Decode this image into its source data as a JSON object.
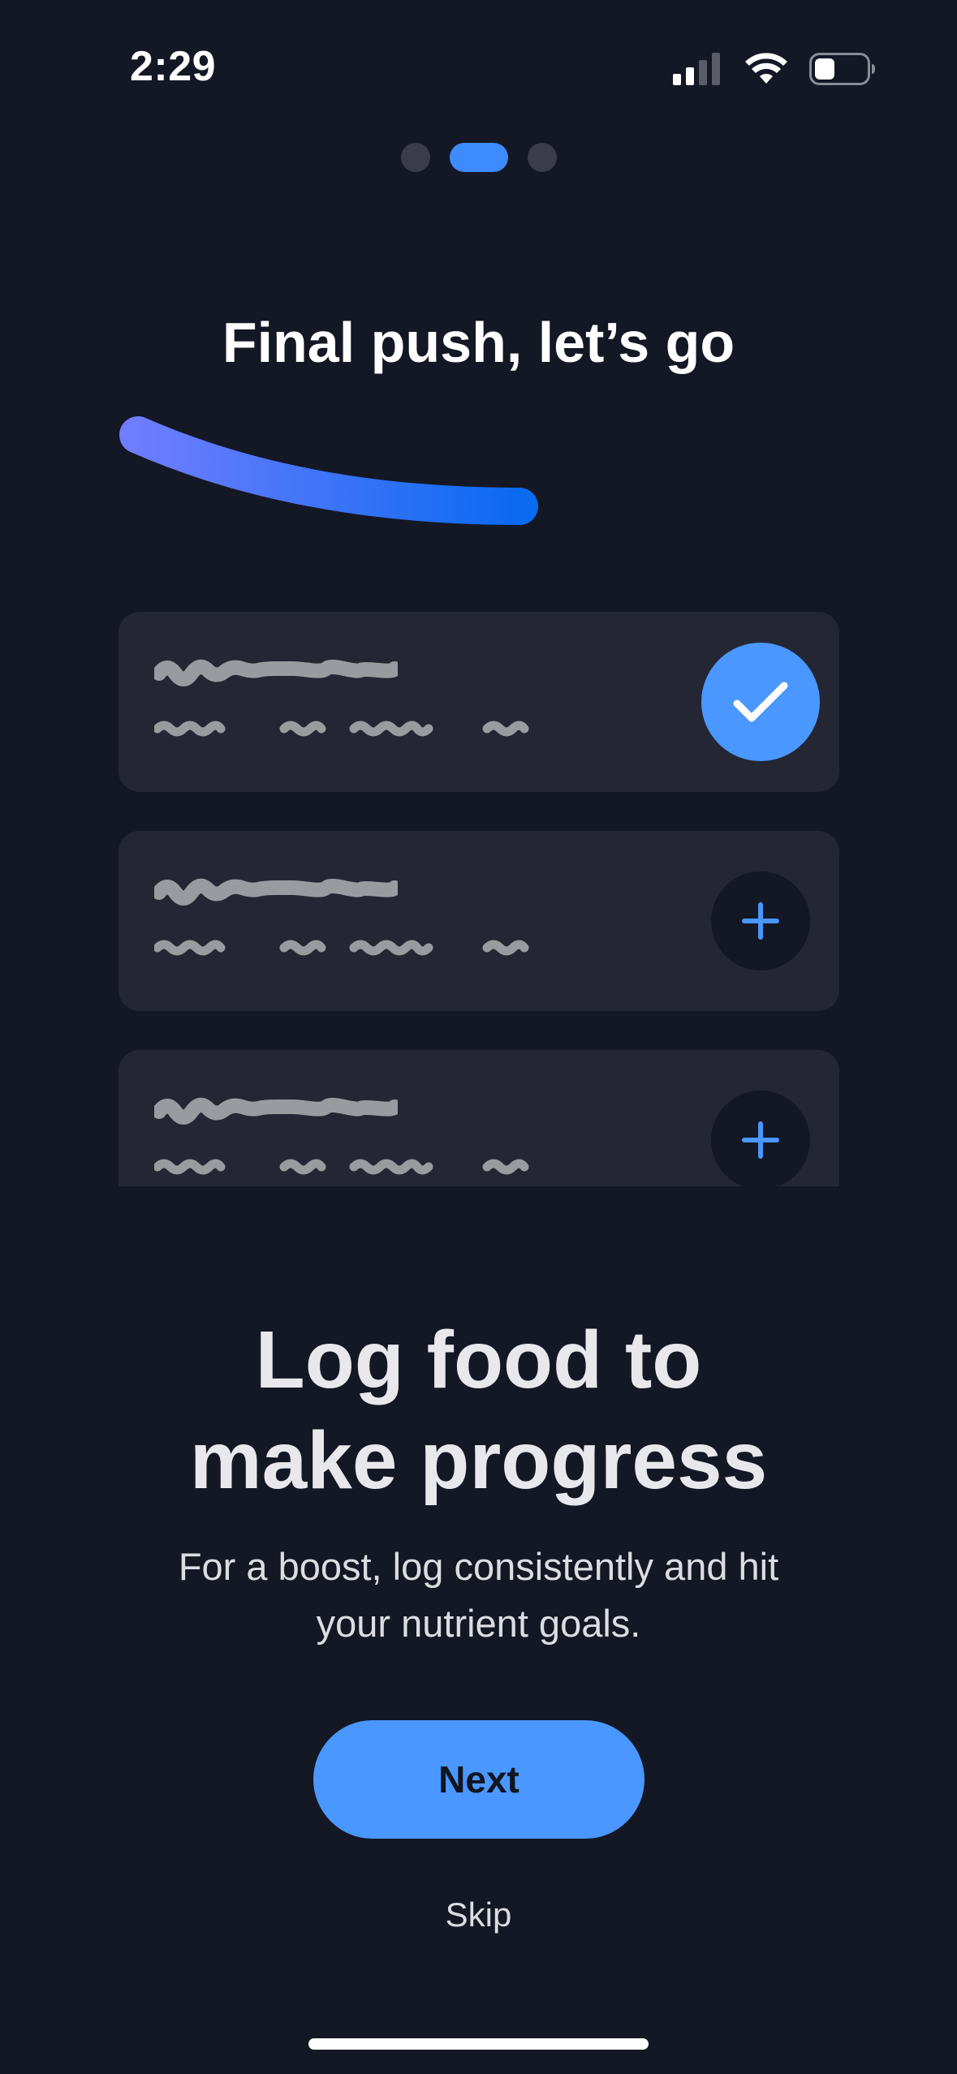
{
  "status_bar": {
    "time": "2:29",
    "icons": [
      "cellular-signal-icon",
      "wifi-icon",
      "battery-icon"
    ]
  },
  "onboarding": {
    "page_count": 3,
    "active_page": 2
  },
  "illustration": {
    "title": "Final push, let’s go",
    "cards": [
      {
        "action_icon": "checkmark-icon",
        "state": "completed"
      },
      {
        "action_icon": "plus-icon",
        "state": "pending"
      },
      {
        "action_icon": "plus-icon",
        "state": "pending"
      }
    ]
  },
  "content": {
    "headline": "Log food to\nmake progress",
    "description": "For a boost, log consistently and hit your nutrient goals."
  },
  "actions": {
    "next_label": "Next",
    "skip_label": "Skip"
  },
  "colors": {
    "background": "#141724",
    "card": "#242733",
    "accent": "#4a97ff",
    "gradient_start": "#6f7dff",
    "gradient_end": "#0a6af0"
  }
}
